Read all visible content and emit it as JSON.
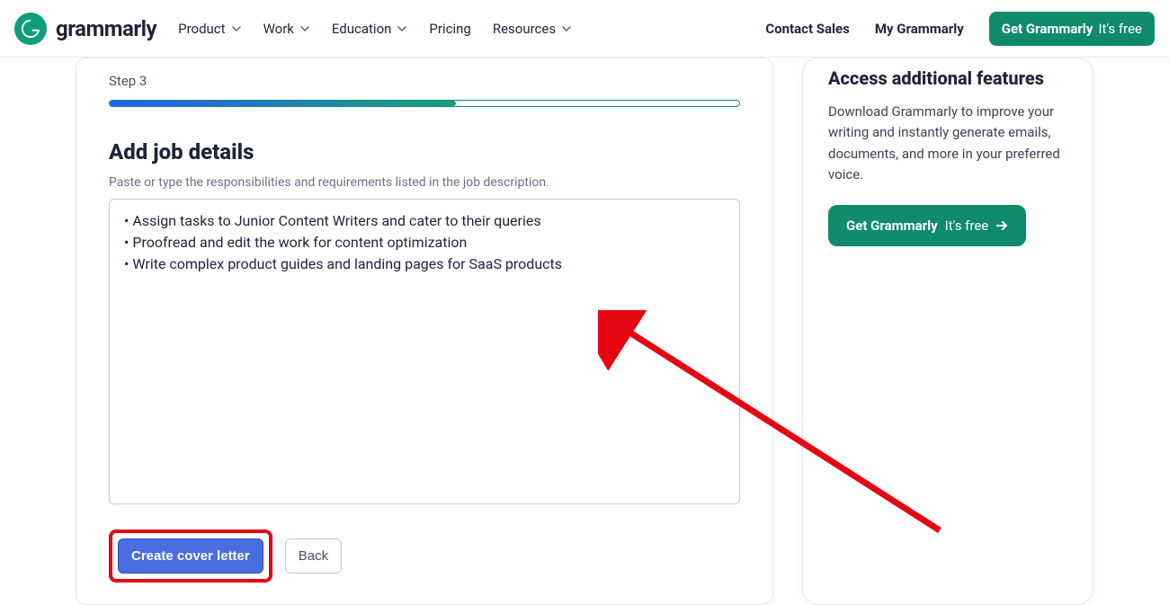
{
  "header": {
    "brand": "grammarly",
    "nav": {
      "product": "Product",
      "work": "Work",
      "education": "Education",
      "pricing": "Pricing",
      "resources": "Resources"
    },
    "contact_sales": "Contact Sales",
    "my_grammarly": "My Grammarly",
    "cta_bold": "Get Grammarly",
    "cta_light": "It's free"
  },
  "main": {
    "step_label": "Step 3",
    "title": "Add job details",
    "subtitle": "Paste or type the responsibilities and requirements listed in the job description.",
    "textarea_value": "• Assign tasks to Junior Content Writers and cater to their queries\n• Proofread and edit the work for content optimization\n• Write complex product guides and landing pages for SaaS products",
    "primary_btn": "Create cover letter",
    "back_btn": "Back"
  },
  "promo": {
    "title": "Access additional features",
    "text": "Download Grammarly to improve your writing and instantly generate emails, documents, and more in your preferred voice.",
    "cta_bold": "Get Grammarly",
    "cta_light": "It's free"
  }
}
